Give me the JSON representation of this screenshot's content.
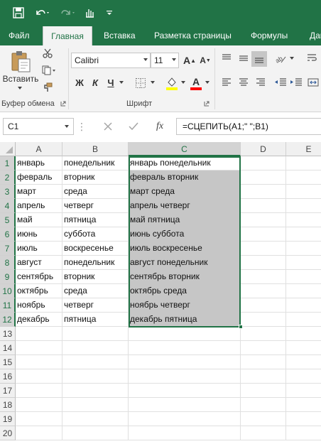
{
  "quick_access": {
    "icons": [
      "save-icon",
      "undo-icon",
      "redo-icon",
      "touch-mode-icon",
      "customize-icon"
    ]
  },
  "tabs": [
    {
      "label": "Файл",
      "active": false
    },
    {
      "label": "Главная",
      "active": true
    },
    {
      "label": "Вставка",
      "active": false
    },
    {
      "label": "Разметка страницы",
      "active": false
    },
    {
      "label": "Формулы",
      "active": false
    },
    {
      "label": "Дан",
      "active": false
    }
  ],
  "ribbon": {
    "paste_label": "Вставить",
    "clipboard_group": "Буфер обмена",
    "font_group": "Шрифт",
    "font_name": "Calibri",
    "font_size": "11",
    "bold": "Ж",
    "italic": "К",
    "underline": "Ч",
    "font_color": "#ff0000",
    "fill_color": "#ffff00"
  },
  "formula_bar": {
    "name_box": "C1",
    "fx": "fx",
    "formula": "=СЦЕПИТЬ(A1;\" \";B1)"
  },
  "sheet": {
    "columns": [
      "A",
      "B",
      "C",
      "D",
      "E"
    ],
    "selected_column": "C",
    "row_numbers": [
      "1",
      "2",
      "3",
      "4",
      "5",
      "6",
      "7",
      "8",
      "9",
      "10",
      "11",
      "12",
      "13",
      "14",
      "15",
      "16",
      "17",
      "18",
      "19",
      "20"
    ],
    "rows": [
      [
        "январь",
        "понедельник",
        "январь понедельник"
      ],
      [
        "февраль",
        "вторник",
        "февраль вторник"
      ],
      [
        "март",
        "среда",
        "март среда"
      ],
      [
        "апрель",
        "четверг",
        "апрель четверг"
      ],
      [
        "май",
        "пятница",
        "май пятница"
      ],
      [
        "июнь",
        "суббота",
        "июнь суббота"
      ],
      [
        "июль",
        "воскресенье",
        "июль воскресенье"
      ],
      [
        "август",
        "понедельник",
        "август понедельник"
      ],
      [
        "сентябрь",
        "вторник",
        "сентябрь вторник"
      ],
      [
        "октябрь",
        "среда",
        "октябрь среда"
      ],
      [
        "ноябрь",
        "четверг",
        "ноябрь четверг"
      ],
      [
        "декабрь",
        "пятница",
        "декабрь пятница"
      ]
    ]
  },
  "colors": {
    "accent": "#217346",
    "selection_fill": "#c6c6c6"
  }
}
